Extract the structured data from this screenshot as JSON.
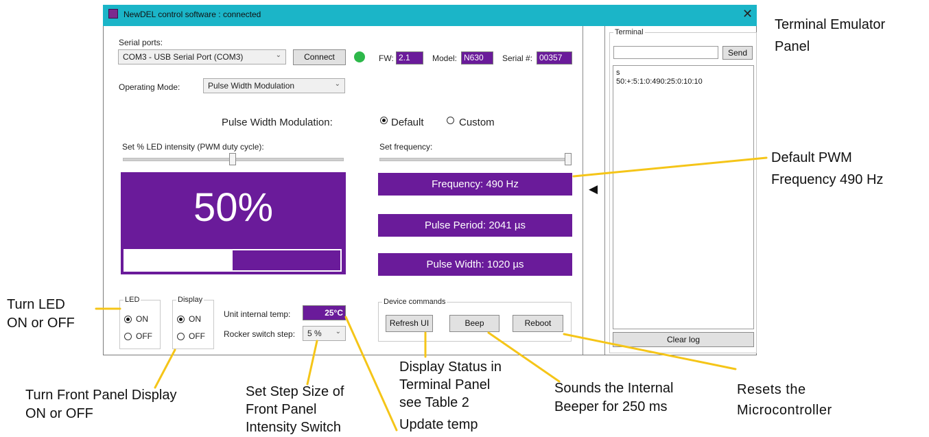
{
  "window": {
    "title": "NewDEL control software : connected",
    "close_glyph": "✕"
  },
  "serial": {
    "label": "Serial ports:",
    "port_value": "COM3 - USB Serial Port (COM3)",
    "connect_label": "Connect",
    "status_color": "#2db84a"
  },
  "device_info": {
    "fw_label": "FW:",
    "fw_value": "2.1",
    "model_label": "Model:",
    "model_value": "N630",
    "serial_label": "Serial #:",
    "serial_value": "00357"
  },
  "mode": {
    "label": "Operating Mode:",
    "value": "Pulse Width Modulation"
  },
  "pwm": {
    "heading": "Pulse Width Modulation:",
    "option_default": "Default",
    "option_custom": "Custom",
    "selected": "Default",
    "intensity_label": "Set % LED intensity (PWM duty cycle):",
    "intensity_fraction": 0.5,
    "intensity_text": "50%",
    "frequency_label": "Set frequency:",
    "frequency_fraction": 1.0,
    "frequency_text": "Frequency: 490 Hz",
    "period_text": "Pulse Period: 2041 µs",
    "width_text": "Pulse Width: 1020 µs"
  },
  "led_group": {
    "title": "LED",
    "on": "ON",
    "off": "OFF",
    "selected": "ON"
  },
  "display_group": {
    "title": "Display",
    "on": "ON",
    "off": "OFF",
    "selected": "ON"
  },
  "temp": {
    "label": "Unit internal temp:",
    "value": "25°C"
  },
  "rocker": {
    "label": "Rocker switch step:",
    "value": "5 %"
  },
  "commands": {
    "title": "Device commands",
    "refresh": "Refresh UI",
    "beep": "Beep",
    "reboot": "Reboot"
  },
  "collapse_glyph": "◀",
  "terminal": {
    "title": "Terminal",
    "input_value": "",
    "send_label": "Send",
    "log_lines": [
      "s",
      "50:+:5:1:0:490:25:0:10:10"
    ],
    "clear_label": "Clear log"
  },
  "annotations": {
    "terminal_panel": [
      "Terminal Emulator",
      "Panel"
    ],
    "default_freq": [
      "Default PWM",
      "Frequency 490 Hz"
    ],
    "turn_led": [
      "Turn LED",
      "ON or OFF"
    ],
    "front_display": [
      "Turn Front Panel Display",
      "ON or OFF"
    ],
    "step_size": [
      "Set Step Size of",
      "Front Panel",
      "Intensity Switch"
    ],
    "display_status": [
      "Display Status in",
      "Terminal Panel",
      "see Table 2"
    ],
    "update_temp": "Update temp",
    "beeper": [
      "Sounds the Internal",
      "Beeper for 250 ms"
    ],
    "resets": [
      "Resets the",
      "Microcontroller"
    ]
  }
}
